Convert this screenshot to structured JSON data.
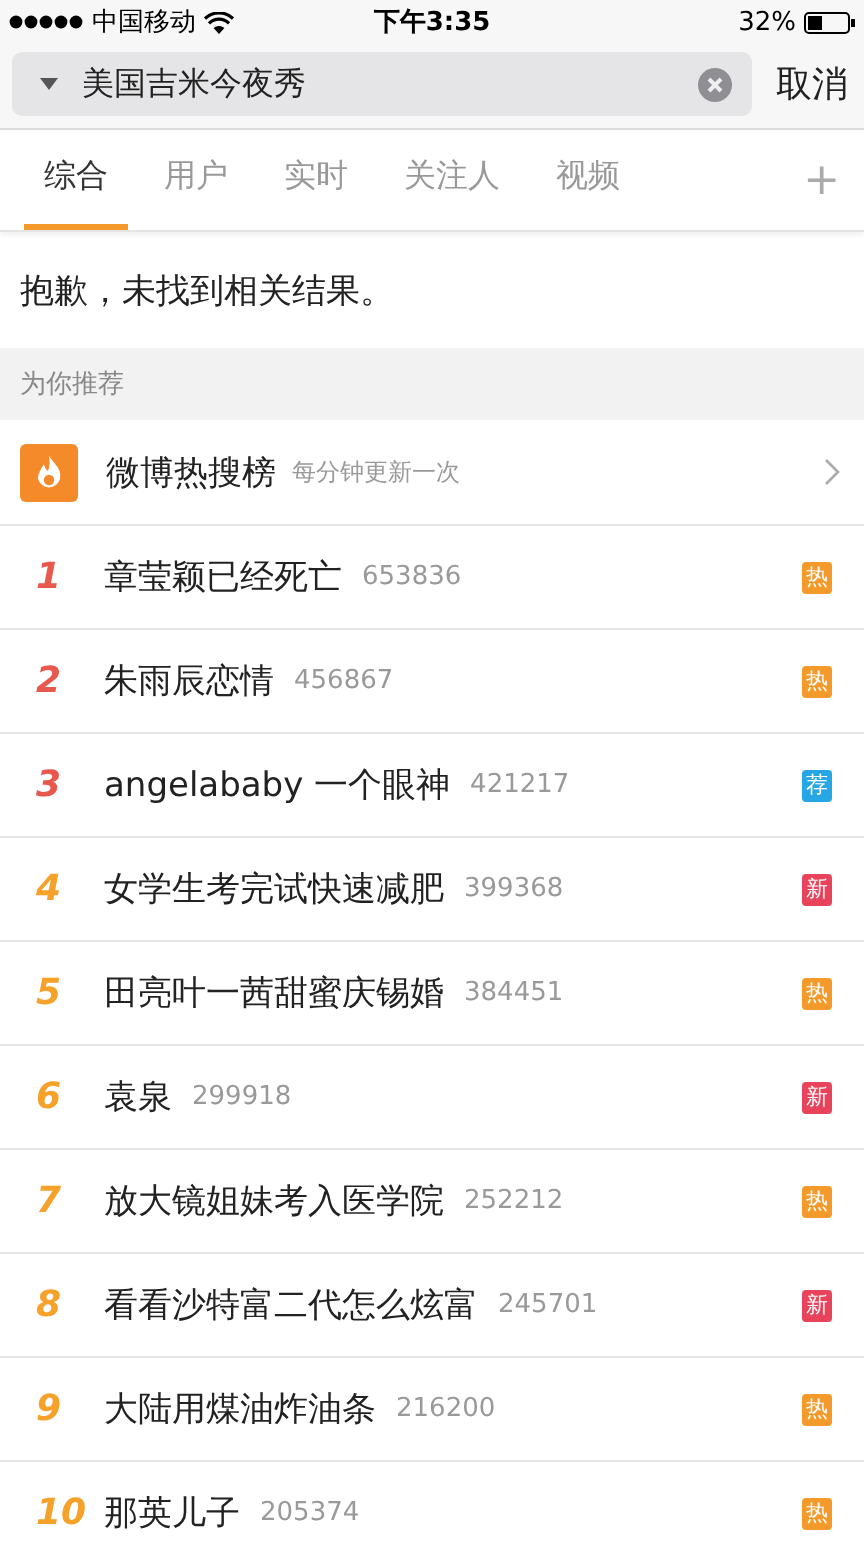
{
  "status_bar": {
    "carrier": "中国移动",
    "time": "下午3:35",
    "battery": "32%"
  },
  "search": {
    "value": "美国吉米今夜秀",
    "cancel": "取消"
  },
  "tabs": [
    {
      "label": "综合",
      "selected": true
    },
    {
      "label": "用户",
      "selected": false
    },
    {
      "label": "实时",
      "selected": false
    },
    {
      "label": "关注人",
      "selected": false
    },
    {
      "label": "视频",
      "selected": false
    }
  ],
  "tabs_more": "+",
  "message": "抱歉，未找到相关结果。",
  "section_title": "为你推荐",
  "hot_list": {
    "title": "微博热搜榜",
    "subtitle": "每分钟更新一次"
  },
  "items": [
    {
      "rank": "1",
      "title": "章莹颖已经死亡",
      "count": "653836",
      "color": "#e9584c",
      "badge": {
        "text": "热",
        "kind": "hot"
      }
    },
    {
      "rank": "2",
      "title": "朱雨辰恋情",
      "count": "456867",
      "color": "#e9584c",
      "badge": {
        "text": "热",
        "kind": "hot"
      }
    },
    {
      "rank": "3",
      "title": "angelababy 一个眼神",
      "count": "421217",
      "color": "#e9584c",
      "badge": {
        "text": "荐",
        "kind": "rec"
      }
    },
    {
      "rank": "4",
      "title": "女学生考完试快速减肥",
      "count": "399368",
      "color": "#f5a12a",
      "badge": {
        "text": "新",
        "kind": "new"
      }
    },
    {
      "rank": "5",
      "title": "田亮叶一茜甜蜜庆锡婚",
      "count": "384451",
      "color": "#f5a12a",
      "badge": {
        "text": "热",
        "kind": "hot"
      }
    },
    {
      "rank": "6",
      "title": "袁泉",
      "count": "299918",
      "color": "#f5a12a",
      "badge": {
        "text": "新",
        "kind": "new"
      }
    },
    {
      "rank": "7",
      "title": "放大镜姐妹考入医学院",
      "count": "252212",
      "color": "#f5a12a",
      "badge": {
        "text": "热",
        "kind": "hot"
      }
    },
    {
      "rank": "8",
      "title": "看看沙特富二代怎么炫富",
      "count": "245701",
      "color": "#f5a12a",
      "badge": {
        "text": "新",
        "kind": "new"
      }
    },
    {
      "rank": "9",
      "title": "大陆用煤油炸油条",
      "count": "216200",
      "color": "#f5a12a",
      "badge": {
        "text": "热",
        "kind": "hot"
      }
    },
    {
      "rank": "10",
      "title": "那英儿子",
      "count": "205374",
      "color": "#f5a12a",
      "badge": {
        "text": "热",
        "kind": "hot"
      }
    }
  ]
}
